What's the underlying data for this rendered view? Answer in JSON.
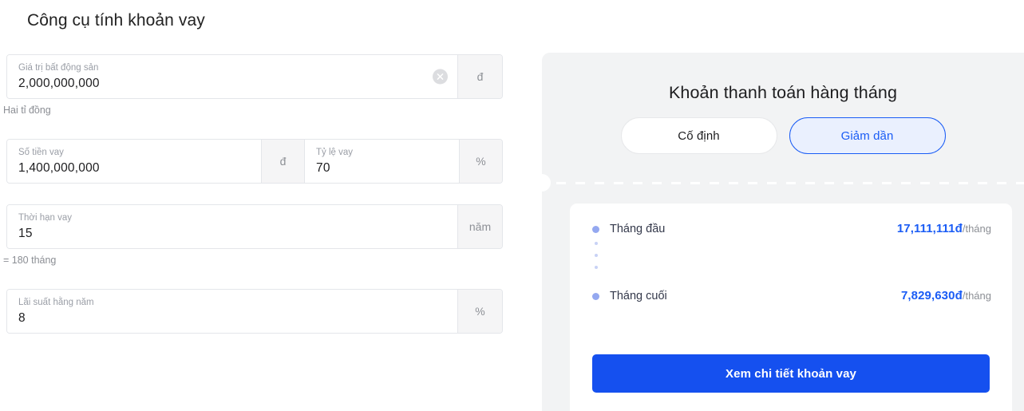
{
  "calculator": {
    "title": "Công cụ tính khoản vay",
    "fields": {
      "property_value": {
        "label": "Giá trị bất động sản",
        "value": "2,000,000,000",
        "suffix": "đ",
        "helper": "Hai tỉ đồng",
        "clear_icon": "clear-circle-icon"
      },
      "loan_amount": {
        "label": "Số tiền vay",
        "value": "1,400,000,000",
        "suffix": "đ"
      },
      "loan_ratio": {
        "label": "Tỷ lệ vay",
        "value": "70",
        "suffix": "%"
      },
      "loan_term": {
        "label": "Thời hạn vay",
        "value": "15",
        "suffix": "năm",
        "helper": "= 180 tháng"
      },
      "interest_rate": {
        "label": "Lãi suất hằng năm",
        "value": "8",
        "suffix": "%"
      }
    }
  },
  "result_panel": {
    "title": "Khoản thanh toán hàng tháng",
    "toggles": [
      {
        "label": "Cố định",
        "selected": false
      },
      {
        "label": "Giảm dần",
        "selected": true
      }
    ],
    "rows": [
      {
        "label": "Tháng đầu",
        "amount": "17,111,111đ",
        "unit": "/tháng"
      },
      {
        "label": "Tháng cuối",
        "amount": "7,829,630đ",
        "unit": "/tháng"
      }
    ],
    "cta_label": "Xem chi tiết khoản vay"
  },
  "colors": {
    "accent_blue": "#1550ef",
    "toggle_active_fill": "#eaf0fe",
    "panel_gray": "#f2f3f4",
    "bullet_blue": "#94a8f0"
  }
}
